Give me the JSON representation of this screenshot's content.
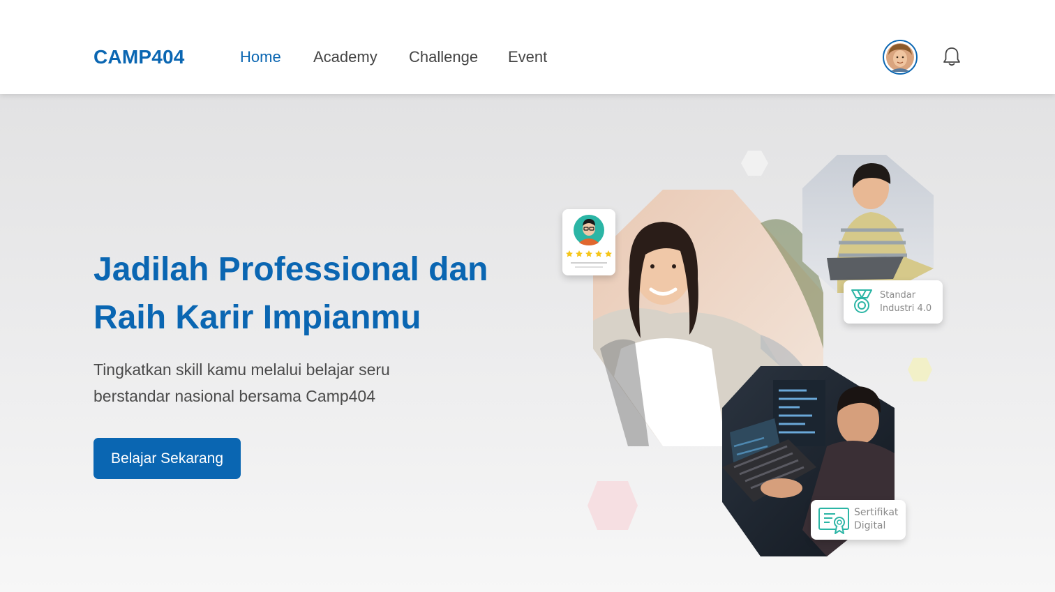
{
  "header": {
    "logo": "CAMP404",
    "nav": [
      {
        "label": "Home",
        "active": true
      },
      {
        "label": "Academy",
        "active": false
      },
      {
        "label": "Challenge",
        "active": false
      },
      {
        "label": "Event",
        "active": false
      }
    ],
    "avatar_icon": "user-avatar",
    "bell_icon": "bell-icon"
  },
  "hero": {
    "title_line1": "Jadilah Professional dan",
    "title_line2": "Raih Karir Impianmu",
    "subtitle_line1": "Tingkatkan skill kamu melalui belajar seru",
    "subtitle_line2": "berstandar nasional bersama Camp404",
    "cta_label": "Belajar Sekarang"
  },
  "illustration": {
    "rating_card": {
      "stars": 5,
      "icon": "profile-rating-icon"
    },
    "badge_standard": {
      "line1": "Standar",
      "line2": "Industri 4.0",
      "icon": "medal-icon"
    },
    "badge_certificate": {
      "line1": "Sertifikat",
      "line2": "Digital",
      "icon": "certificate-icon"
    }
  },
  "colors": {
    "primary": "#0a66b2",
    "text_dark": "#444444",
    "accent_teal": "#2bb5a5",
    "star": "#f5c518"
  }
}
